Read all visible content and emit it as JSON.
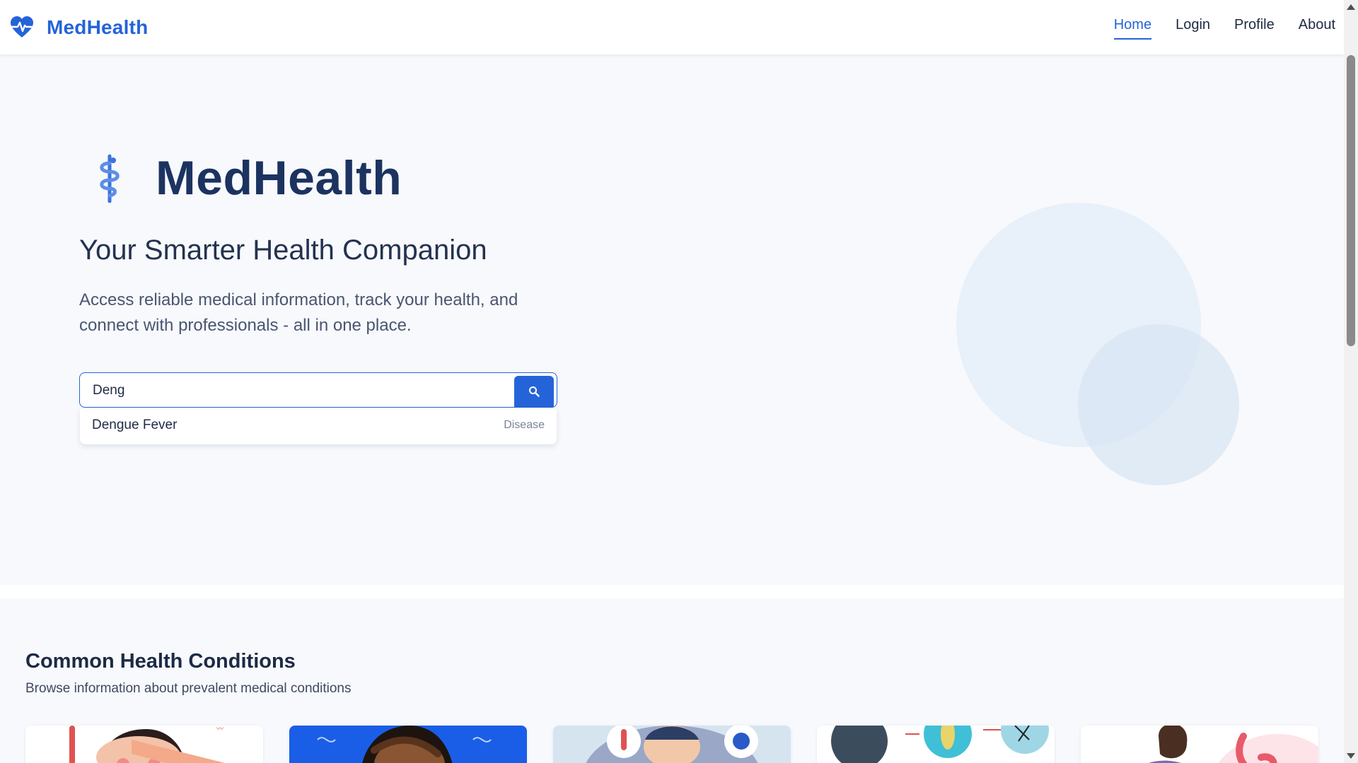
{
  "brand": {
    "name": "MedHealth",
    "logo_icon": "heart-pulse-icon",
    "color": "#2563d9"
  },
  "nav": {
    "items": [
      {
        "label": "Home",
        "active": true
      },
      {
        "label": "Login",
        "active": false
      },
      {
        "label": "Profile",
        "active": false
      },
      {
        "label": "About",
        "active": false
      }
    ]
  },
  "hero": {
    "logo_icon": "caduceus-icon",
    "title": "MedHealth",
    "subtitle": "Your Smarter Health Companion",
    "description": "Access reliable medical information, track your health, and connect with professionals - all in one place."
  },
  "search": {
    "value": "Deng",
    "button_icon": "search-icon",
    "suggestions": [
      {
        "name": "Dengue Fever",
        "type": "Disease"
      }
    ]
  },
  "conditions": {
    "title": "Common Health Conditions",
    "subtitle": "Browse information about prevalent medical conditions",
    "cards": [
      {
        "image": "fever-illustration"
      },
      {
        "image": "headache-illustration"
      },
      {
        "image": "flu-virus-illustration"
      },
      {
        "image": "mosquito-lifecycle-illustration"
      },
      {
        "image": "stomach-pain-illustration"
      }
    ]
  },
  "colors": {
    "accent": "#2563d9",
    "heading": "#1c3360",
    "background": "#f7f9fc"
  }
}
